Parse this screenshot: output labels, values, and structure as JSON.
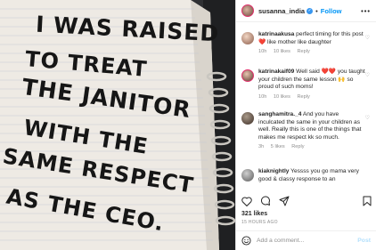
{
  "header": {
    "username": "susanna_india",
    "separator": "•",
    "follow_label": "Follow",
    "more_label": "•••"
  },
  "photo": {
    "lines": [
      "I WAS RAISED",
      "TO TREAT",
      "THE JANITOR",
      "WITH THE",
      "SAME RESPECT",
      "AS THE CEO."
    ]
  },
  "comments": [
    {
      "user": "katrinaakusa",
      "text": "perfect timing for this post ❤️ like mother like daughter",
      "age": "10h",
      "likes": "10 likes",
      "reply": "Reply"
    },
    {
      "user": "katrinakaif09",
      "text": "Well said ❤️❤️ you taught your children the same lesson 🙌 so proud of such moms!",
      "age": "10h",
      "likes": "10 likes",
      "reply": "Reply"
    },
    {
      "user": "sanghamitra._4",
      "text": "And you have inculcated the same in your children as well. Really this is one of the things that makes me respect kk so much.",
      "age": "3h",
      "likes": "5 likes",
      "reply": "Reply"
    },
    {
      "user": "kiaknightly",
      "text": "Yessss you go mama very good & classy response to an",
      "age": "",
      "likes": "",
      "reply": ""
    }
  ],
  "footer": {
    "likes_count": "321 likes",
    "timestamp": "15 HOURS AGO",
    "add_comment_placeholder": "Add a comment...",
    "post_label": "Post"
  },
  "icons": {
    "like": "heart-icon",
    "comment": "comment-icon",
    "share": "share-icon",
    "save": "bookmark-icon",
    "emoji": "emoji-icon"
  },
  "colors": {
    "accent": "#0095f6",
    "post_disabled": "#b2dffc",
    "verified": "#3897f0"
  }
}
